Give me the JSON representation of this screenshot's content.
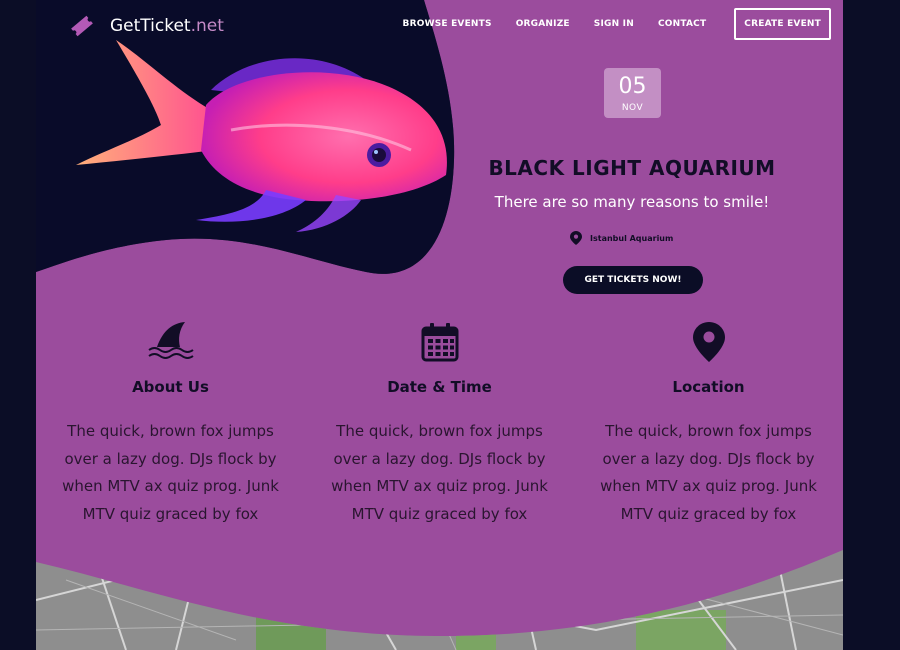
{
  "logo": {
    "name": "GetTicket",
    "tld": ".net"
  },
  "nav": {
    "browse": "BROWSE EVENTS",
    "organize": "ORGANIZE",
    "signin": "SIGN IN",
    "contact": "CONTACT",
    "create": "CREATE EVENT"
  },
  "event": {
    "day": "05",
    "month": "NOV",
    "title": "BLACK LIGHT AQUARIUM",
    "tagline": "There are so many reasons to smile!",
    "venue": "Istanbul Aquarium",
    "cta": "GET TICKETS NOW!"
  },
  "features": [
    {
      "title": "About Us",
      "text": "The quick, brown fox jumps over a lazy dog. DJs flock by when MTV ax quiz prog. Junk MTV quiz graced by fox",
      "icon": "shark-fin-icon"
    },
    {
      "title": "Date & Time",
      "text": "The quick, brown fox jumps over a lazy dog. DJs flock by when MTV ax quiz prog. Junk MTV quiz graced by fox",
      "icon": "calendar-icon"
    },
    {
      "title": "Location",
      "text": "The quick, brown fox jumps over a lazy dog. DJs flock by when MTV ax quiz prog. Junk MTV quiz graced by fox",
      "icon": "map-pin-icon"
    }
  ],
  "colors": {
    "background": "#0b0d26",
    "accent": "#9b4c9d",
    "badge": "#c38fc4",
    "dark": "#120d26"
  }
}
